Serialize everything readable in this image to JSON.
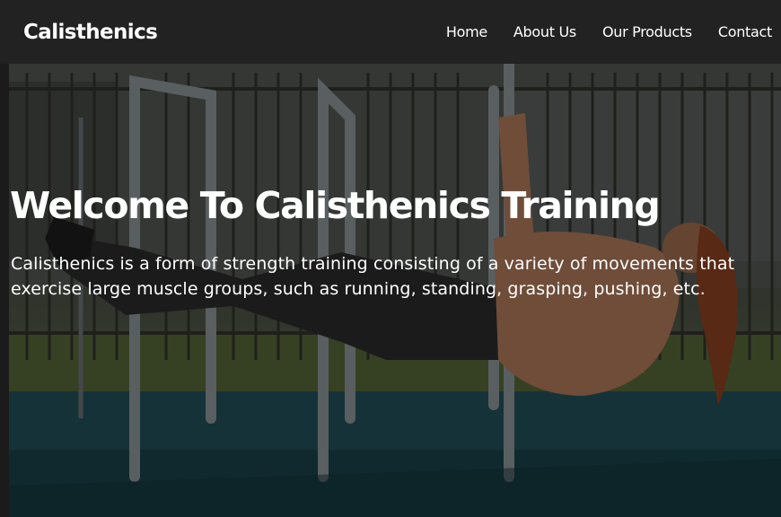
{
  "navbar": {
    "brand": "Calisthenics",
    "links": [
      "Home",
      "About Us",
      "Our Products",
      "Contact"
    ]
  },
  "hero": {
    "title": "Welcome To Calisthenics Training",
    "description": "Calisthenics is a form of strength training consisting of a variety of movements that exercise large muscle groups, such as running, standing, grasping, pushing, etc.",
    "image_subject": "athlete-human-flag-on-parallel-bars"
  },
  "colors": {
    "navbar_bg": "#222222",
    "text": "#ffffff",
    "ground": "#1d4049"
  }
}
